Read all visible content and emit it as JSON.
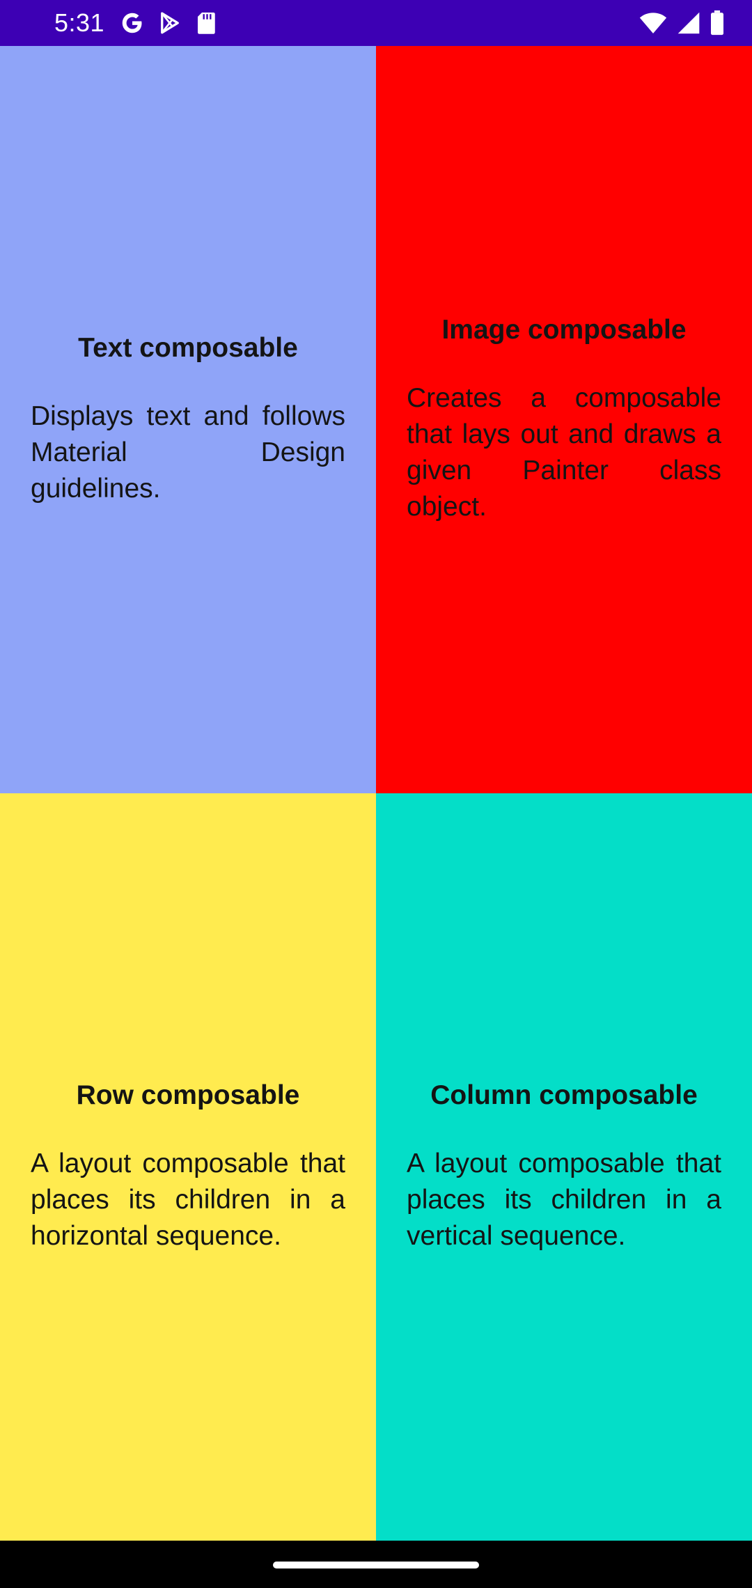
{
  "status_bar": {
    "time": "5:31",
    "background": "#3d00b4",
    "left_icons": [
      "google-g-icon",
      "play-store-icon",
      "sd-card-icon"
    ],
    "right_icons": [
      "wifi-icon",
      "cellular-signal-icon",
      "battery-icon"
    ]
  },
  "quadrants": [
    {
      "title": "Text composable",
      "body": "Displays text and follows Material Design guidelines.",
      "color": "#8fa4f8"
    },
    {
      "title": "Image composable",
      "body": "Creates a composable that lays out and draws a given Painter class object.",
      "color": "#ff0000"
    },
    {
      "title": "Row composable",
      "body": "A layout composable that places its children in a horizontal sequence.",
      "color": "#ffeb4f"
    },
    {
      "title": "Column composable",
      "body": "A layout composable that places its children in a vertical sequence.",
      "color": "#04dec8"
    }
  ]
}
